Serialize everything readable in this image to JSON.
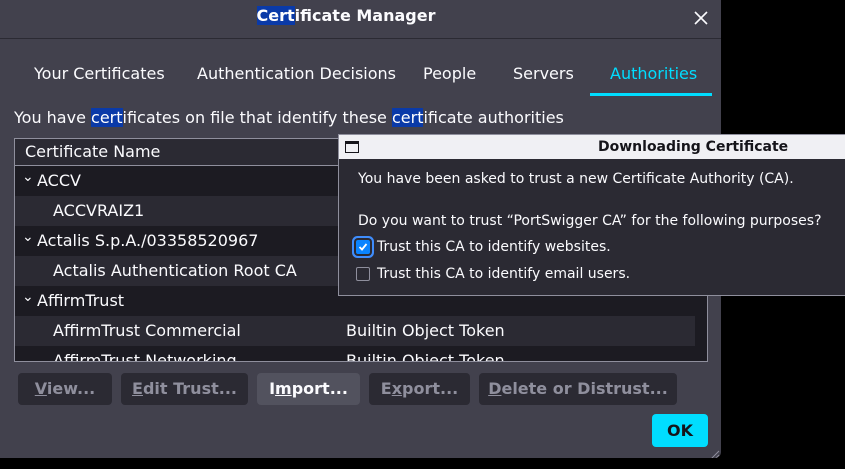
{
  "cert_manager": {
    "title_highlight": "Cert",
    "title_rest": "ificate Manager",
    "tabs": [
      {
        "label": "Your Certificates"
      },
      {
        "label": "Authentication Decisions"
      },
      {
        "label": "People"
      },
      {
        "label": "Servers"
      },
      {
        "label": "Authorities",
        "selected": true
      }
    ],
    "description": {
      "p1": "You have ",
      "h1": "cert",
      "p2": "ificates on file that identify these ",
      "h2": "cert",
      "p3": "ificate authorities"
    },
    "tree": {
      "column_header": "Certificate Name",
      "rows": [
        {
          "label": "ACCV",
          "type": "group",
          "expanded": true
        },
        {
          "label": "ACCVRAIZ1",
          "type": "cert",
          "device": ""
        },
        {
          "label": "Actalis S.p.A./03358520967",
          "type": "group",
          "expanded": true
        },
        {
          "label": "Actalis Authentication Root CA",
          "type": "cert",
          "device": ""
        },
        {
          "label": "AffirmTrust",
          "type": "group",
          "expanded": true
        },
        {
          "label": "AffirmTrust Commercial",
          "type": "cert",
          "device": "Builtin Object Token"
        },
        {
          "label": "AffirmTrust Networking",
          "type": "cert",
          "device": "Builtin Object Token"
        }
      ]
    },
    "buttons": {
      "view": {
        "mnemonic": "V",
        "rest": "iew..."
      },
      "edit_trust": {
        "mnemonic": "E",
        "rest": "dit Trust..."
      },
      "import": {
        "before": "I",
        "mnemonic": "m",
        "rest": "port..."
      },
      "export": {
        "before": "E",
        "mnemonic": "x",
        "rest": "port..."
      },
      "delete": {
        "mnemonic": "D",
        "rest": "elete or Distrust..."
      }
    },
    "ok_label": "OK"
  },
  "download_dialog": {
    "title": "Downloading Certificate",
    "intro": "You have been asked to trust a new Certificate Authority (CA).",
    "question": "Do you want to trust “PortSwigger CA” for the following purposes?",
    "options": [
      {
        "label": "Trust this CA to identify websites.",
        "checked": true
      },
      {
        "label": "Trust this CA to identify email users.",
        "checked": false
      }
    ]
  },
  "colors": {
    "accent": "#00ddff",
    "highlight": "#0a3aa8",
    "checkbox_checked": "#0a84ff",
    "dialog_bg": "#42414d",
    "tree_bg": "#1c1b22"
  }
}
